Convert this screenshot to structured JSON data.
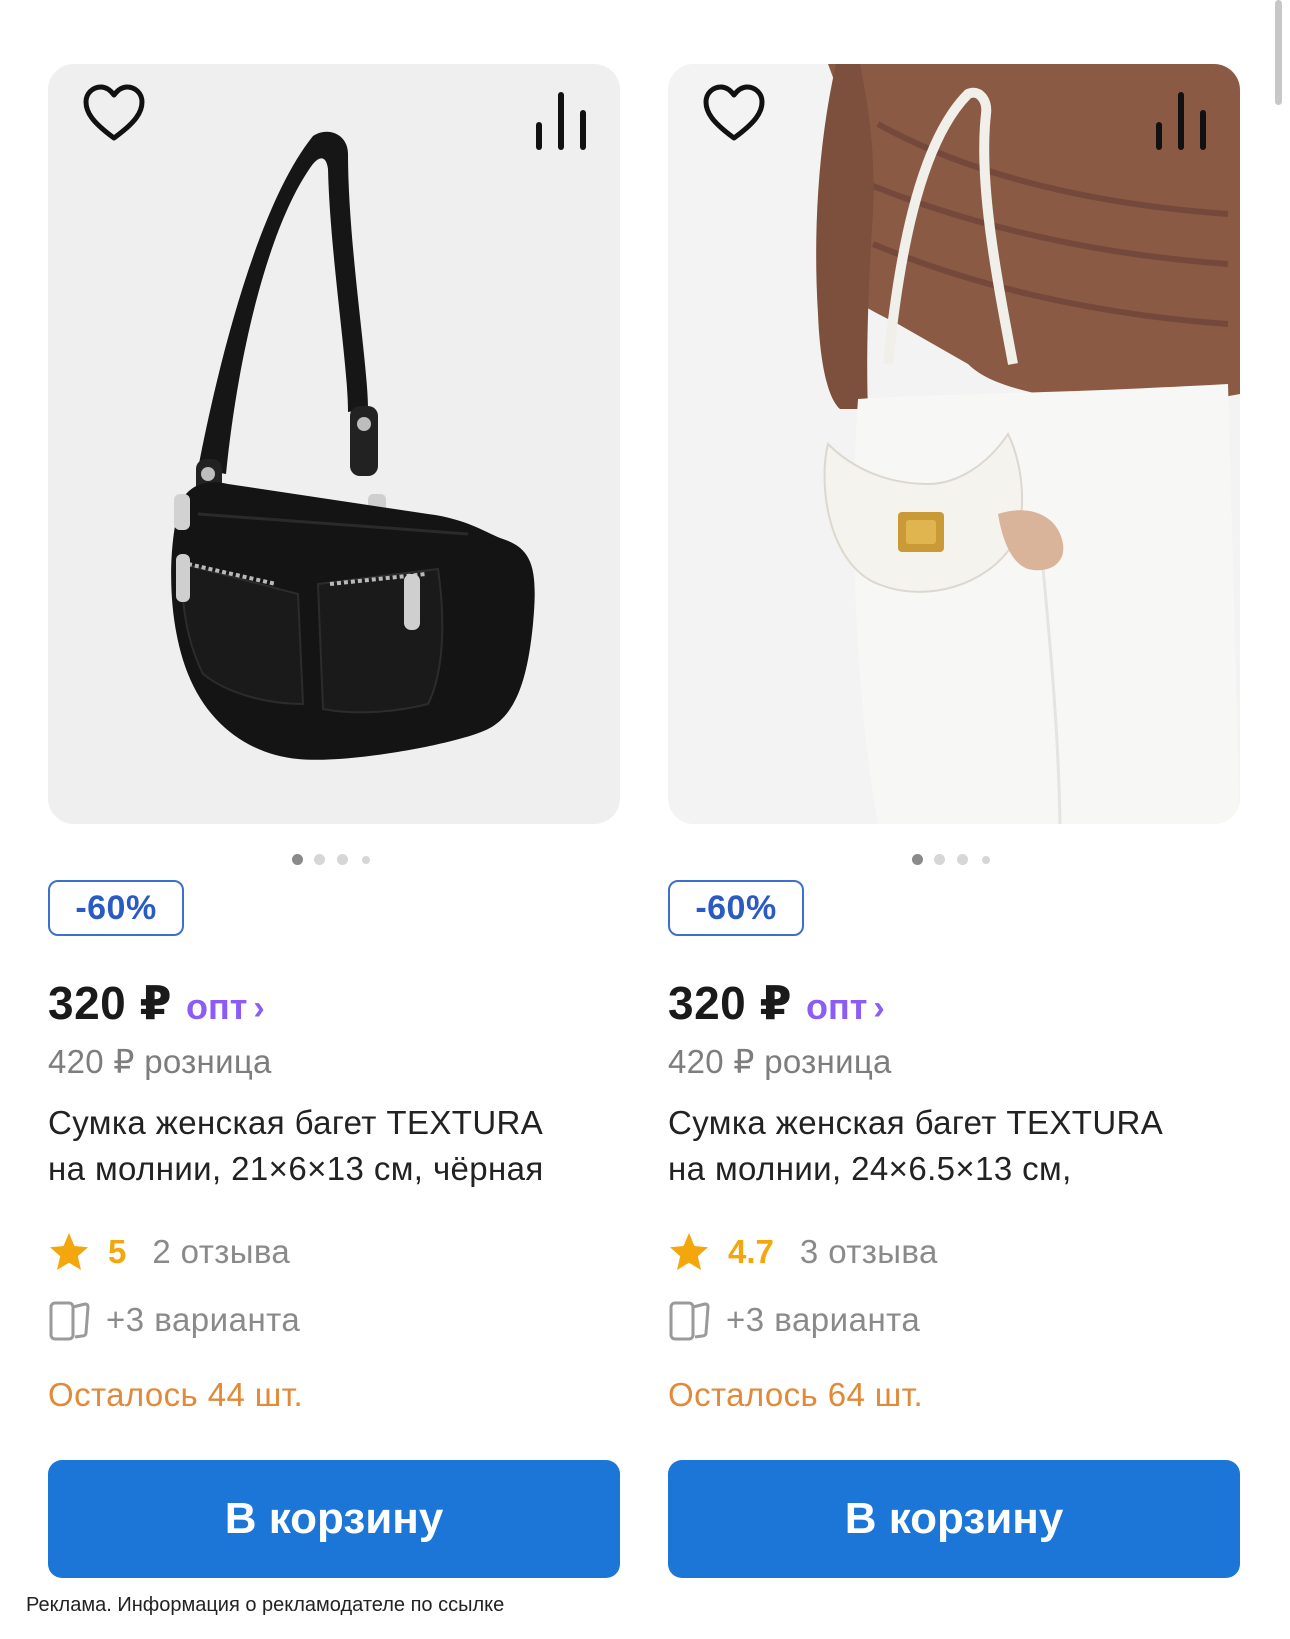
{
  "products": [
    {
      "discount": "-60%",
      "price": "320 ₽",
      "price_type": "опт",
      "retail_price": "420 ₽ розница",
      "title_line1": "Сумка женская багет TEXTURA",
      "title_line2": "на молнии, 21×6×13 см, чёрная",
      "rating": "5",
      "reviews": "2 отзыва",
      "variants": "+3 варианта",
      "stock": "Осталось 44 шт.",
      "cart_label": "В корзину",
      "image": "black shoulder bag with two zippered pockets"
    },
    {
      "discount": "-60%",
      "price": "320 ₽",
      "price_type": "опт",
      "retail_price": "420 ₽ розница",
      "title_line1": "Сумка женская багет TEXTURA",
      "title_line2": "на молнии, 24×6.5×13 см,",
      "rating": "4.7",
      "reviews": "3 отзыва",
      "variants": "+3 варианта",
      "stock": "Осталось 64 шт.",
      "cart_label": "В корзину",
      "image": "white crescent bag with gold clasp held by model in brown top"
    }
  ],
  "ad_notice": "Реклама. Информация о рекламодателе по ссылке",
  "icons": {
    "favorite": "heart-icon",
    "compare": "compare-bars-icon",
    "rating": "star-icon",
    "variants": "variants-cards-icon",
    "chevron": "chevron-right-icon"
  },
  "colors": {
    "accent_purple": "#8b5cf6",
    "cart_blue": "#1b76d8",
    "badge_blue": "#2a5bc4",
    "stock_orange": "#e08a3a",
    "star_yellow": "#f4a70c"
  }
}
